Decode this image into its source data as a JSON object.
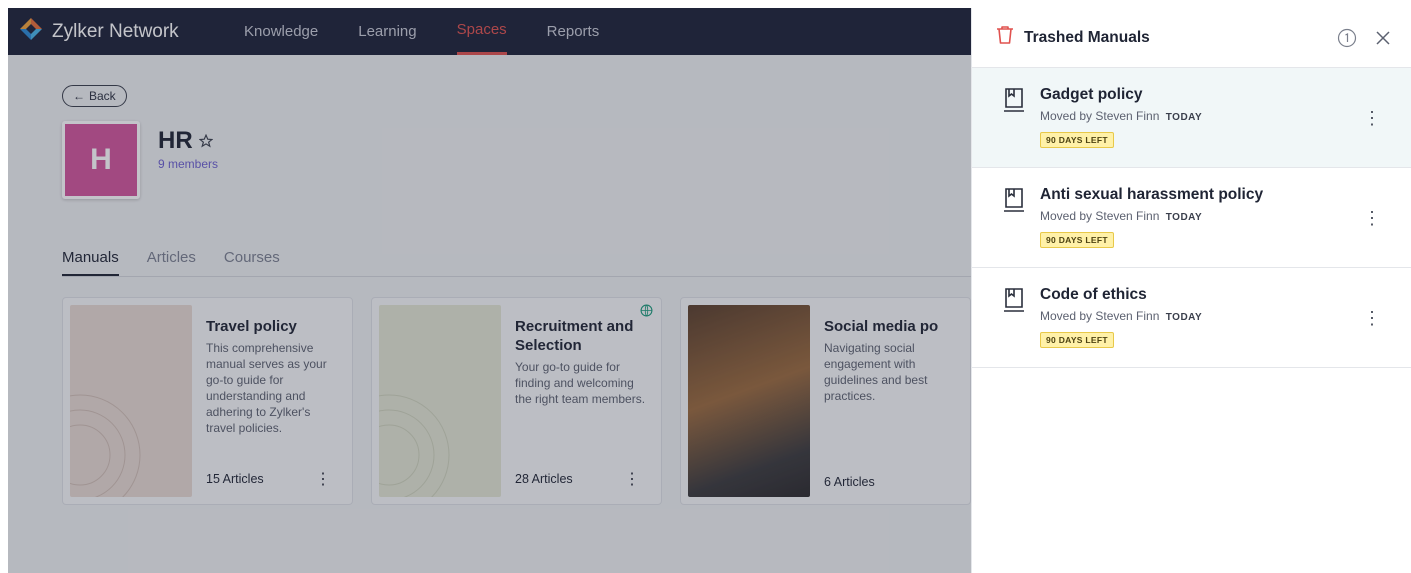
{
  "nav": {
    "brand": "Zylker Network",
    "items": [
      {
        "label": "Knowledge",
        "active": false
      },
      {
        "label": "Learning",
        "active": false
      },
      {
        "label": "Spaces",
        "active": true
      },
      {
        "label": "Reports",
        "active": false
      }
    ]
  },
  "space": {
    "back_label": "Back",
    "avatar_letter": "H",
    "name": "HR",
    "members": "9 members"
  },
  "tabs": [
    {
      "label": "Manuals",
      "active": true
    },
    {
      "label": "Articles",
      "active": false
    },
    {
      "label": "Courses",
      "active": false
    }
  ],
  "cards": [
    {
      "title": "Travel policy",
      "description": "This comprehensive manual serves as your go-to guide for understanding and adhering to Zylker's travel policies.",
      "count": "15 Articles"
    },
    {
      "title": "Recruitment and Selection",
      "description": "Your go-to guide for finding and welcoming the right team members.",
      "count": "28 Articles"
    },
    {
      "title": "Social media po",
      "description": "Navigating social engagement with guidelines and best practices.",
      "count": "6 Articles"
    }
  ],
  "panel": {
    "title": "Trashed Manuals",
    "items": [
      {
        "title": "Gadget policy",
        "moved_by": "Moved by Steven Finn",
        "when": "TODAY",
        "badge": "90 DAYS LEFT"
      },
      {
        "title": "Anti sexual harassment policy",
        "moved_by": "Moved by Steven Finn",
        "when": "TODAY",
        "badge": "90 DAYS LEFT"
      },
      {
        "title": "Code of ethics",
        "moved_by": "Moved by Steven Finn",
        "when": "TODAY",
        "badge": "90 DAYS LEFT"
      }
    ]
  },
  "colors": {
    "nav_bg": "#1d2238",
    "accent": "#e0524f",
    "avatar": "#d1559b",
    "badge_bg": "#fff1a8"
  }
}
